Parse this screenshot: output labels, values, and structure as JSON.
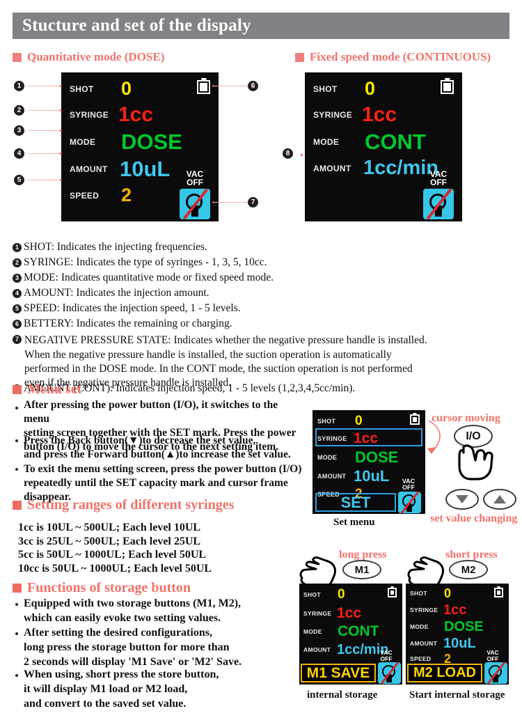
{
  "title": "Stucture and set of the dispaly",
  "sections": {
    "quant_mode": "Quantitative mode (DOSE)",
    "fixed_mode": "Fixed speed mode (CONTINUOUS)",
    "menu_set": "Menu set",
    "setting_ranges": "Setting ranges of different syringes",
    "storage_functions": "Functions of storage button"
  },
  "display_labels": {
    "shot": "SHOT",
    "syringe": "SYRINGE",
    "mode": "MODE",
    "amount": "AMOUNT",
    "speed": "SPEED",
    "vac": "VAC",
    "off": "OFF"
  },
  "dose_panel": {
    "shot": "0",
    "syringe": "1cc",
    "mode": "DOSE",
    "amount": "10uL",
    "speed": "2"
  },
  "cont_panel": {
    "shot": "0",
    "syringe": "1cc",
    "mode": "CONT",
    "amount": "1cc/min"
  },
  "set_panel": {
    "shot": "0",
    "syringe": "1cc",
    "mode": "DOSE",
    "amount": "10uL",
    "speed": "2",
    "set_label": "SET",
    "caption": "Set menu"
  },
  "m1_panel": {
    "shot": "0",
    "syringe": "1cc",
    "mode": "CONT",
    "amount": "1cc/min",
    "bar": "M1 SAVE",
    "button": "M1",
    "press": "long press",
    "caption": "internal storage"
  },
  "m2_panel": {
    "shot": "0",
    "syringe": "1cc",
    "mode": "DOSE",
    "amount": "10uL",
    "speed": "2",
    "bar": "M2 LOAD",
    "button": "M2",
    "press": "short press",
    "caption": "Start internal storage"
  },
  "callouts": {
    "n1": "❶",
    "n2": "❷",
    "n3": "❸",
    "n4": "❹",
    "n5": "❺",
    "n6": "❻",
    "n7": "❼",
    "n8": "❽"
  },
  "legend": [
    {
      "num": "❶",
      "text": "SHOT: Indicates the injecting frequencies."
    },
    {
      "num": "❷",
      "text": "SYRINGE: Indicates the type of syringes - 1, 3, 5, 10cc."
    },
    {
      "num": "❸",
      "text": "MODE: Indicates quantitative mode or fixed speed mode."
    },
    {
      "num": "❹",
      "text": "AMOUNT: Indicates the injection amount."
    },
    {
      "num": "❺",
      "text": "SPEED: Indicates the injection speed, 1 - 5 levels."
    },
    {
      "num": "❻",
      "text": "BETTERY: Indicates the remaining or charging."
    }
  ],
  "legend7": {
    "num": "❼",
    "text": "NEGATIVE PRESSURE STATE: Indicates whether the negative pressure handle is installed.\nWhen the negative pressure handle is installed, the suction operation is automatically\nperformed in the DOSE mode. In the CONT mode, the suction operation is not performed\neven if the negative pressure handle is installed."
  },
  "legend8": {
    "num": "❽",
    "text": "AMOUNT (CONT): Indicates injection speed, 1 - 5 levels (1,2,3,4,5cc/min)."
  },
  "menu_set_bullets": [
    "After pressing the power button (I/O), it switches to the menu\nsetting screen together with the SET mark. Press the power\nbutton (I/O) to move the cursor to the next setting item.",
    "Press the Back button(▼)to decrease the set value,\nand press the Forward button(▲)to increase the set value.",
    "To exit the menu setting screen, press the power button (I/O)\nrepeatedly until the SET capacity mark and cursor frame disappear."
  ],
  "menu_annotations": {
    "cursor_moving": "cursor moving",
    "set_value_changing": "set value changing",
    "io_button": "I/O"
  },
  "ranges": "1cc is 10UL ~ 500UL; Each level 10UL\n3cc is 25UL ~ 500UL; Each level 25UL\n5cc is 50UL ~ 1000UL; Each level 50UL\n10cc is 50UL ~ 1000UL; Each level 50UL",
  "storage_bullets": [
    "Equipped with two storage buttons (M1, M2),\nwhich can easily evoke two setting values.",
    "After setting the desired configurations,\nlong press the storage button for more than\n 2 seconds will display 'M1 Save' or 'M2' Save.",
    "When using, short press the store button,\nit will display M1 load or M2 load,\nand convert to the saved set value."
  ],
  "colors": {
    "title_bar": "#808285",
    "accent_red": "#f2726a",
    "screen_bg": "#0b0b0b",
    "yellow": "#ffe800",
    "red": "#ff1f16",
    "green": "#00c92b",
    "cyan": "#3fc8f0",
    "orange": "#ffb400",
    "vac_tile": "#36c6e8",
    "slash": "#d8282e",
    "cursor_blue": "#2f9fe0",
    "mem_gold": "#f5b400"
  }
}
